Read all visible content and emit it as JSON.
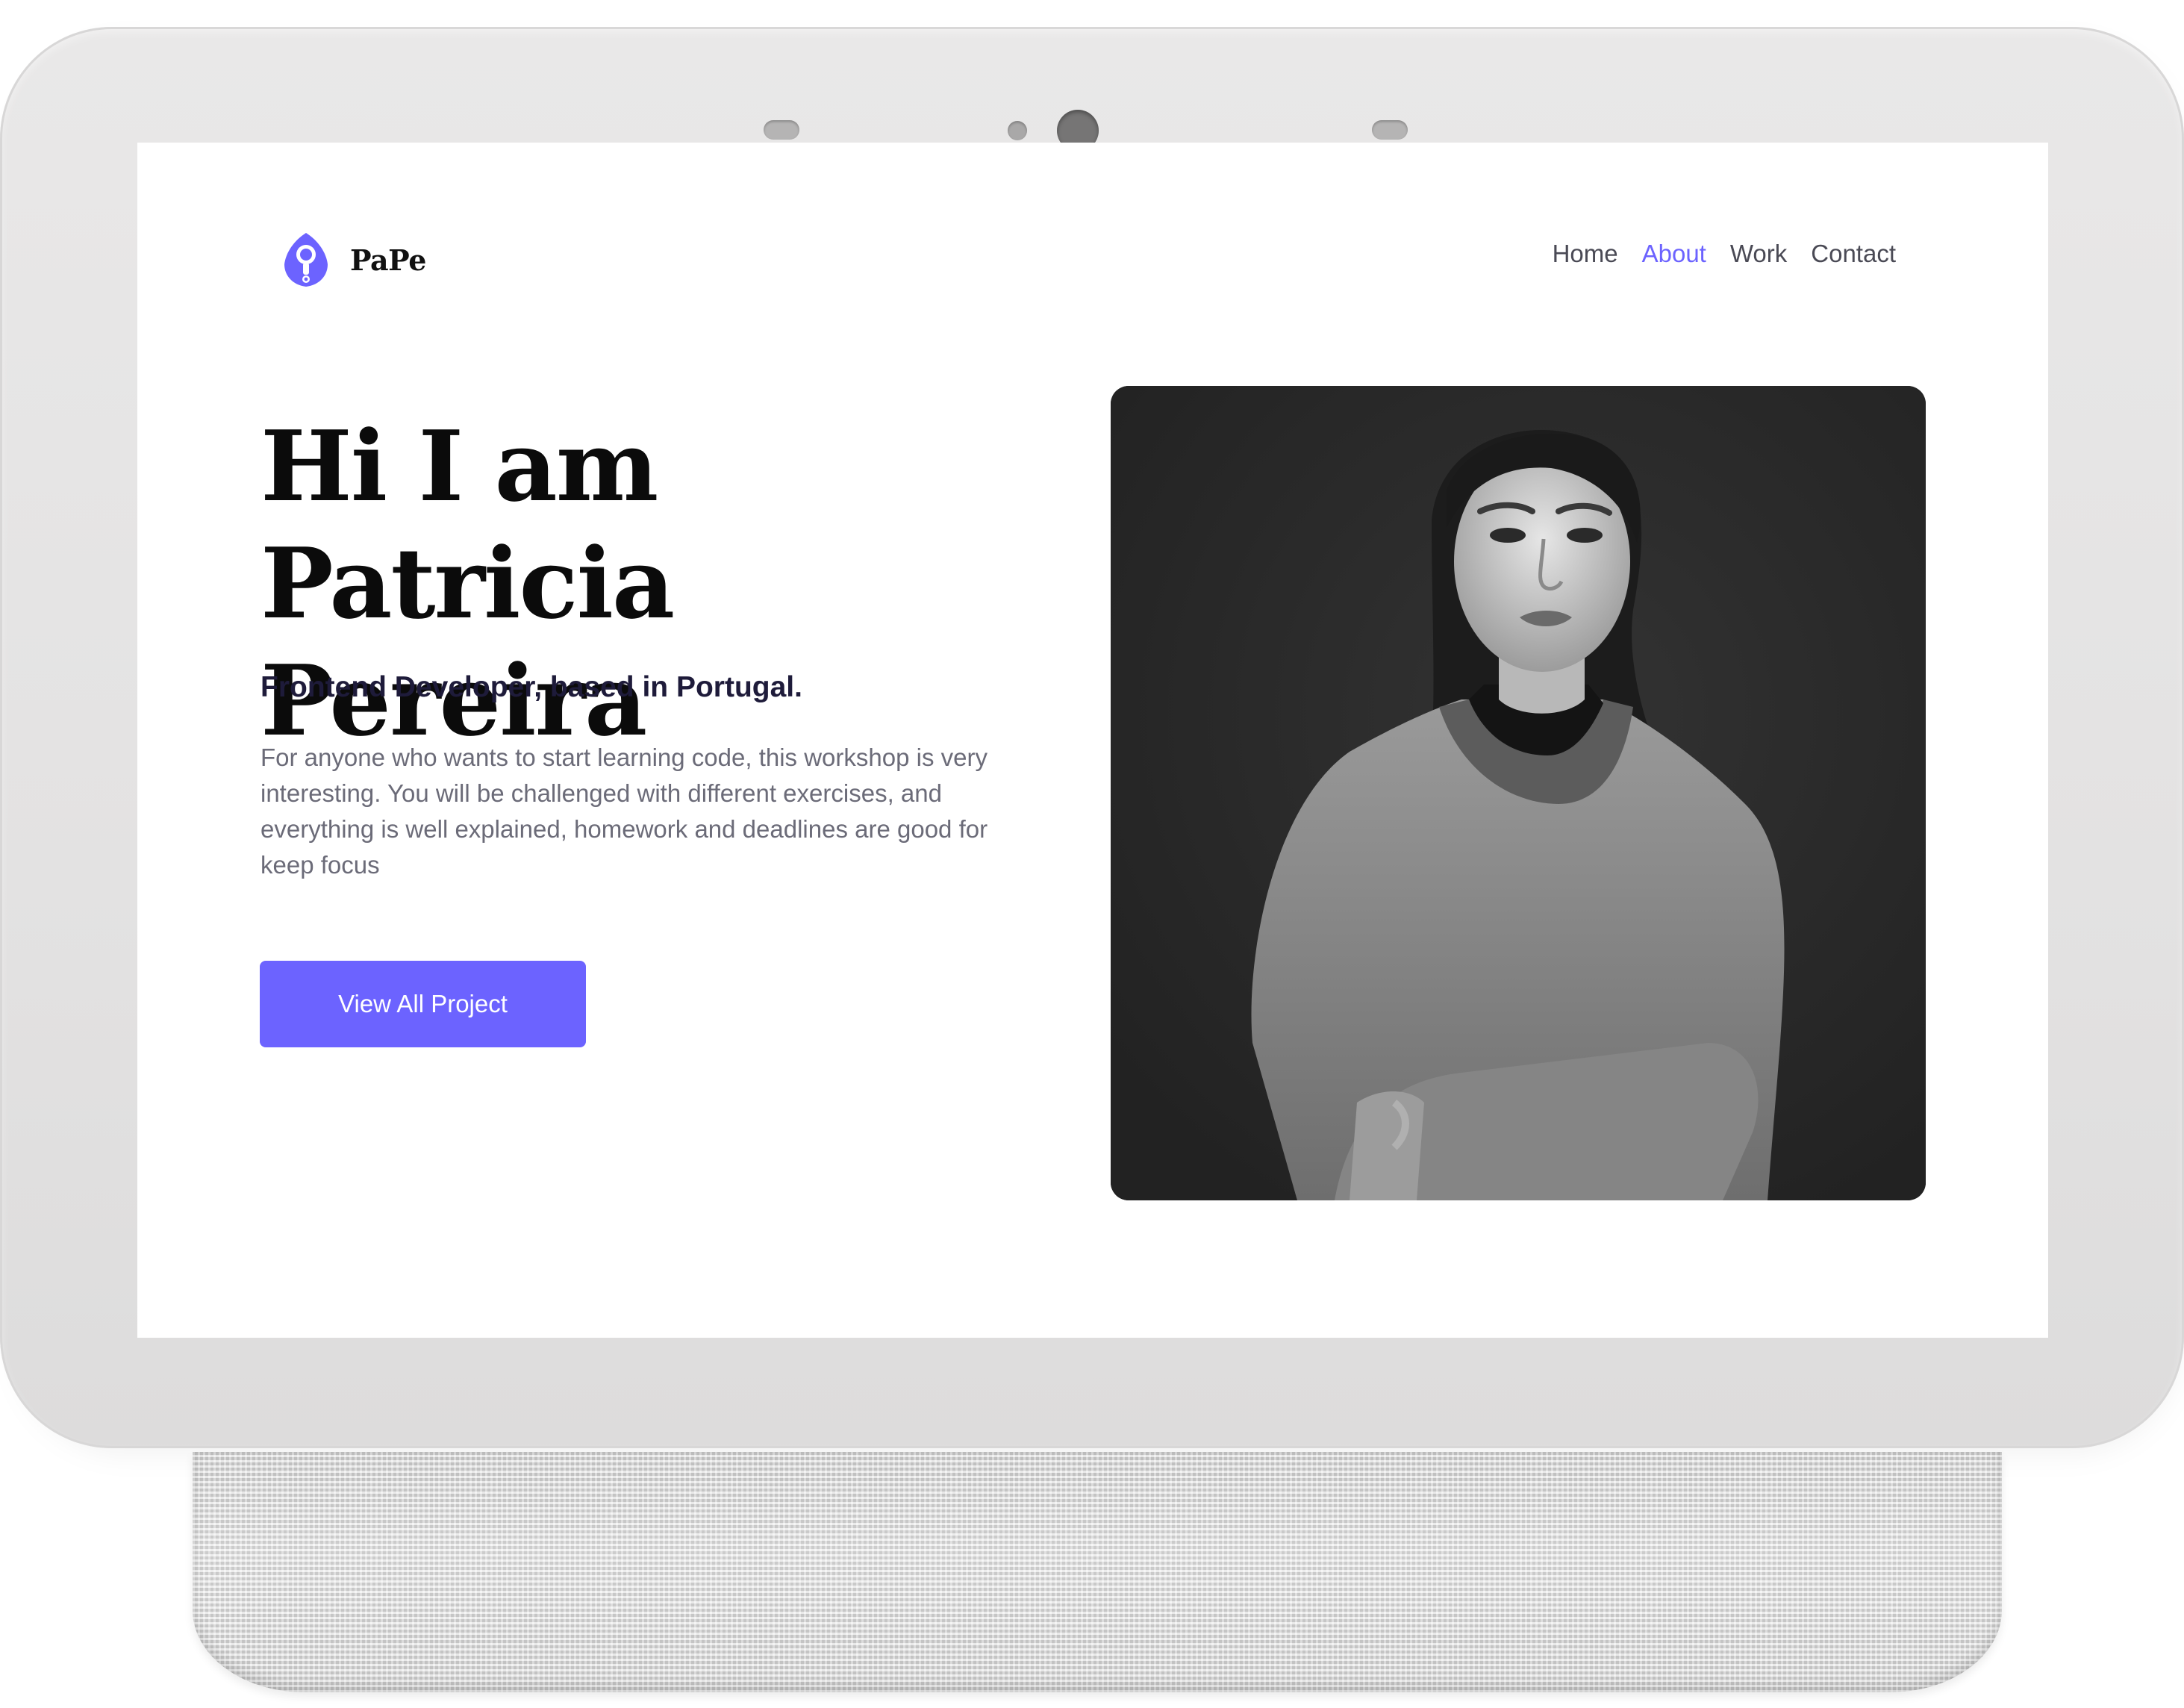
{
  "brand": {
    "name": "PaPe",
    "logo_icon": "location-pin-logo-icon",
    "accent_color": "#6c63ff"
  },
  "nav": {
    "items": [
      {
        "label": "Home",
        "active": false
      },
      {
        "label": "About",
        "active": true
      },
      {
        "label": "Work",
        "active": false
      },
      {
        "label": "Contact",
        "active": false
      }
    ],
    "active_color": "#6c63ff"
  },
  "hero": {
    "title_line1": "Hi I am Patricia",
    "title_line2": "Pereira",
    "subtitle": "Frontend Developer, based in Portugal.",
    "description": "For anyone who wants to start learning code, this workshop is very interesting. You will be challenged with different exercises, and everything is well explained, homework and deadlines are good for keep focus",
    "cta_label": "View All Project",
    "photo_alt": "Black and white portrait of a woman in a hoodie"
  }
}
